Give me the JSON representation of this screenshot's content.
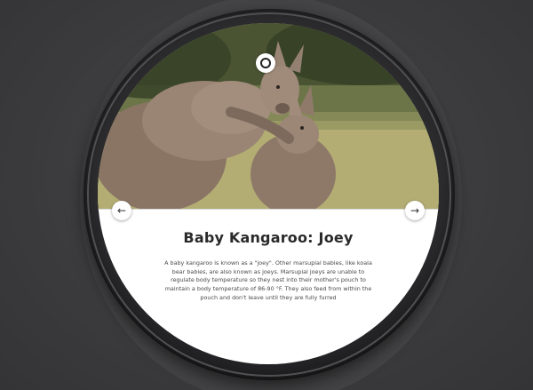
{
  "article": {
    "title": "Baby Kangaroo: Joey",
    "body": "A baby kangaroo is known as a \"joey\". Other marsupial babies, like koala bear babies, are also known as joeys. Marsupial joeys are unable to regulate body temperature so they nest into their mother's pouch to maintain a body temperature of 86-90 °F. They also feed from within the pouch and don't leave until they are fully furred"
  },
  "navigation": {
    "prev_icon": "←",
    "next_icon": "→"
  },
  "icons": {
    "top_indicator": "circle-ring-icon",
    "prev": "arrow-left-icon",
    "next": "arrow-right-icon"
  },
  "colors": {
    "background": "#3c3c3e",
    "screen": "#ffffff",
    "title": "#2a2a2a",
    "body_text": "#4a4a4a"
  }
}
